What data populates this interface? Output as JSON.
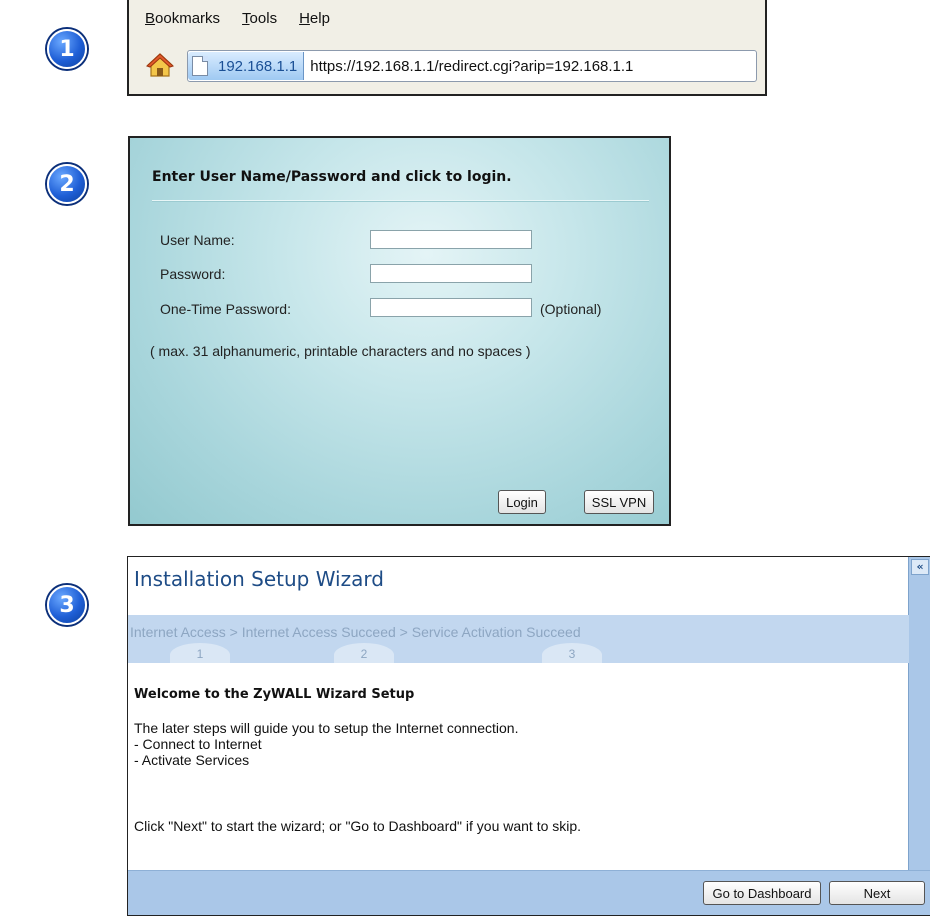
{
  "badges": [
    "1",
    "2",
    "3"
  ],
  "browser": {
    "menu": [
      {
        "label": "Bookmarks",
        "mnemonic": "B",
        "rest": "ookmarks"
      },
      {
        "label": "Tools",
        "mnemonic": "T",
        "rest": "ools"
      },
      {
        "label": "Help",
        "mnemonic": "H",
        "rest": "elp"
      }
    ],
    "site_identity": "192.168.1.1",
    "url": "https://192.168.1.1/redirect.cgi?arip=192.168.1.1",
    "icons": [
      "home-icon",
      "page-icon"
    ]
  },
  "login": {
    "heading": "Enter User Name/Password and click to login.",
    "user_name_label": "User Name:",
    "password_label": "Password:",
    "otp_label": "One-Time Password:",
    "optional_label": "(Optional)",
    "user_name_value": "",
    "password_value": "",
    "otp_value": "",
    "note": "( max. 31 alphanumeric, printable characters and no spaces )",
    "login_button": "Login",
    "sslvpn_button": "SSL VPN"
  },
  "wizard": {
    "title": "Installation Setup Wizard",
    "collapse_icon": "«",
    "steps": [
      {
        "label": "Internet Access",
        "number": "1"
      },
      {
        "label": "Internet Access Succeed",
        "number": "2"
      },
      {
        "label": "Service Activation Succeed",
        "number": "3"
      }
    ],
    "separator": ">",
    "welcome_heading": "Welcome to the ZyWALL Wizard Setup",
    "intro": "The later steps will guide you to setup the Internet connection.",
    "bullet1": "- Connect to Internet",
    "bullet2": "- Activate Services",
    "instruction": "Click \"Next\" to start the wizard; or \"Go to Dashboard\" if you want to skip.",
    "dashboard_button": "Go to Dashboard",
    "next_button": "Next"
  },
  "colors": {
    "badge_blue": "#1f5fd6",
    "wizard_title": "#1e4c86",
    "steps_bar": "#c2d7ef",
    "footer_bar": "#aac7e8",
    "login_bg": "#a9d6dc"
  }
}
